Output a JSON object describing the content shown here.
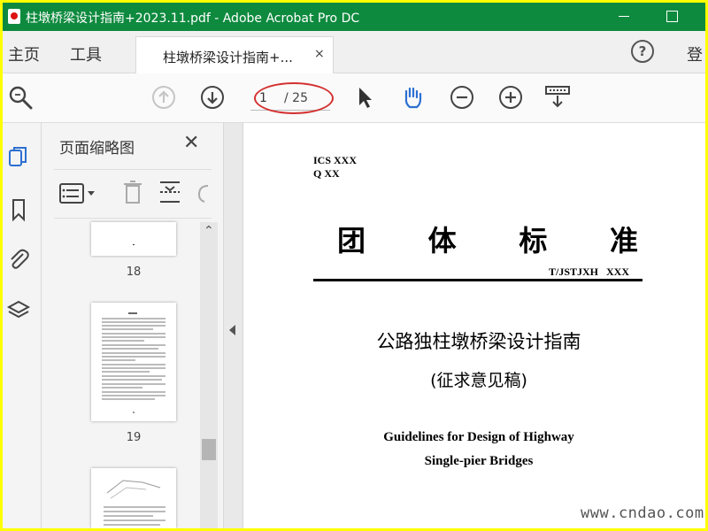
{
  "window": {
    "title": "柱墩桥梁设计指南+2023.11.pdf - Adobe Acrobat Pro DC"
  },
  "tabs": {
    "home": "主页",
    "tools": "工具",
    "document": "柱墩桥梁设计指南+...",
    "close_glyph": "×",
    "help": "?",
    "login": "登"
  },
  "toolbar": {
    "current_page": "1",
    "total_pages": "/ 25"
  },
  "thumbnails": {
    "panel_title": "页面缩略图",
    "close_glyph": "✕",
    "pages": [
      "18",
      "19"
    ]
  },
  "document": {
    "ics": "ICS XXX",
    "q": "Q XX",
    "standard_type": [
      "团",
      "体",
      "标",
      "准"
    ],
    "standard_code": "T/JSTJXH   XXX",
    "title_cn": "公路独柱墩桥梁设计指南",
    "subtitle_cn": "(征求意见稿)",
    "title_en_line1": "Guidelines for Design of Highway",
    "title_en_line2": "Single-pier Bridges"
  },
  "watermark": "www.cndao.com",
  "colors": {
    "titlebar": "#0e8a3e",
    "highlight_ellipse": "#d43030",
    "frame_border": "#ffff00",
    "accent_blue": "#2d6fd1"
  }
}
